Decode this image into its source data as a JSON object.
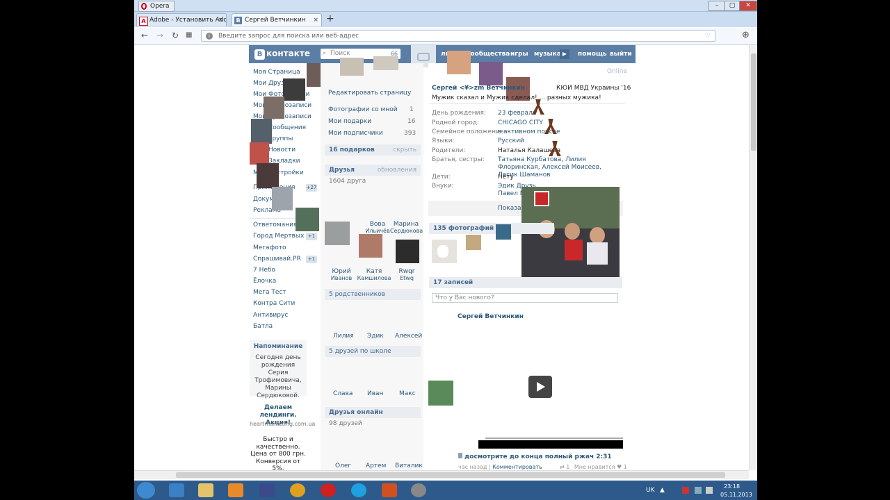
{
  "browser": {
    "menu_label": "Opera",
    "tabs": [
      {
        "title": "Adobe - Установить Adobe",
        "icon": "adobe-icon",
        "active": false
      },
      {
        "title": "Сергей Ветчинкин",
        "icon": "vk-icon",
        "active": true
      }
    ],
    "address_placeholder": "Введите запрос для поиска или веб-адрес"
  },
  "vk": {
    "logo": "контакте",
    "search_placeholder": "Поиск",
    "search_count": "66",
    "top_menu": [
      "люди",
      "сообщества",
      "игры",
      "музыка",
      "помощь",
      "выйти"
    ]
  },
  "left_menu": {
    "items": [
      "Моя Страница",
      "Мои Друзья",
      "Мои Фотографии",
      "Мои Видеозаписи",
      "Мои Аудиозаписи",
      "Мои Сообщения",
      "Мои Группы",
      "Мои Новости",
      "Мои Закладки",
      "Мои Настройки",
      "Приложения",
      "Документы",
      "Реклама"
    ],
    "apps": [
      "Ответомания",
      "Город Мертвых",
      "Мегафото",
      "Спрашивай.PR",
      "7 Небо",
      "Ёлочка",
      "Мега Тест",
      "Контра Сити",
      "Антивирус",
      "Батла"
    ],
    "badge_apps": "+27",
    "badge_gorod": "+1",
    "badge_spr": "+1",
    "reminder_title": "Напоминание",
    "reminder_text": "Сегодня день рождения Серия Трофимовича, Марины Сердюковой.",
    "ad1_title": "Делаем лендинги. Акция!",
    "ad1_url": "heartmarketing.com.ua",
    "ad2_text": "Быстро и качественно. Цена от 800 грн. Конверсия от 5%."
  },
  "middle": {
    "edit_page": "Редактировать страницу",
    "photos_with_me": "Фотографии со мной",
    "photos_with_me_count": "1",
    "my_gifts": "Мои подарки",
    "my_gifts_count": "16",
    "my_followers": "Мои подписчики",
    "my_followers_count": "393",
    "gifts_head": "16 подарков",
    "gifts_hide": "скрыть",
    "friends_head": "Друзья",
    "friends_updates": "обновления",
    "friends_count": "1604 друга",
    "friends": [
      {
        "first": "Вова",
        "last": "Ильичёв"
      },
      {
        "first": "Марина",
        "last": "Сердюкова"
      },
      {
        "first": "Юрий",
        "last": "Иванов"
      },
      {
        "first": "Катя",
        "last": "Камшилова"
      },
      {
        "first": "Rwqr",
        "last": "Etwq"
      }
    ],
    "relatives_head": "5 родственников",
    "relatives": [
      "Лилия",
      "Эдик",
      "Алексей"
    ],
    "school_head": "5 друзей по школе",
    "school": [
      "Слава",
      "Иван",
      "Макс"
    ],
    "online_head": "Друзья онлайн",
    "online_count": "98 друзей",
    "online": [
      "Олег",
      "Артем",
      "Виталик"
    ]
  },
  "profile": {
    "status_online": "Online",
    "name": "Сергей <¥>zm Ветчинкин",
    "school": "КЮИ МВД Украины '16",
    "status": "Мужик сказал и Мужик сделал! ... разных мужика!",
    "fields": [
      {
        "label": "День рождения:",
        "value": "23 февраля"
      },
      {
        "label": "Родной город:",
        "value": "CHICAGO CITY"
      },
      {
        "label": "Семейное положение:",
        "value": "в активном поиске"
      },
      {
        "label": "Языки:",
        "value": "Русский"
      },
      {
        "label": "Родители:",
        "value": "Наталья Калашева"
      },
      {
        "label": "Братья, сестры:",
        "value": "Татьяна Курбатова, Лилия Флоринская, Алексей Моисеев, Лесик Шаманов"
      },
      {
        "label": "Дети:",
        "value": "Нету"
      },
      {
        "label": "Внуки:",
        "value": "Эдик Друзь, Павел М..."
      }
    ],
    "show_more": "Показать",
    "photos_head": "135 фотографий",
    "posts_head": "17 записей",
    "post_placeholder": "Что у Вас нового?",
    "post_author": "Сергей Ветчинкин",
    "video_title": "досмотрите до конца полный ржач 2:31",
    "post_time": "час назад",
    "post_comment": "Комментировать",
    "post_likes_label": "Мне нравится",
    "post_repost_count": "1",
    "post_like_count": "1"
  },
  "taskbar": {
    "lang": "UK",
    "time": "23:18",
    "date": "05.11.2013"
  }
}
